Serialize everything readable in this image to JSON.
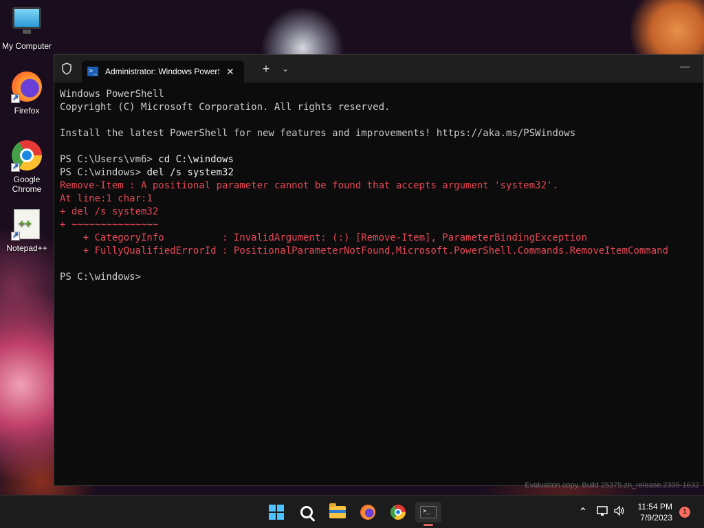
{
  "desktop": {
    "icons": [
      {
        "label": "My Computer",
        "icon": "monitor-icon"
      },
      {
        "label": "Firefox",
        "icon": "firefox-icon"
      },
      {
        "label": "Google Chrome",
        "icon": "chrome-icon"
      },
      {
        "label": "Notepad++",
        "icon": "notepad-plus-plus-icon"
      }
    ],
    "watermark": "Evaluation copy. Build 25375.zn_release.2305-1632"
  },
  "terminal": {
    "tab_title": "Administrator: Windows PowerShell",
    "tab_close": "✕",
    "new_tab": "+",
    "dropdown": "⌄",
    "minimize": "—",
    "lines": [
      {
        "text": "Windows PowerShell",
        "kind": "normal"
      },
      {
        "text": "Copyright (C) Microsoft Corporation. All rights reserved.",
        "kind": "normal"
      },
      {
        "text": "",
        "kind": "normal"
      },
      {
        "text": "Install the latest PowerShell for new features and improvements! https://aka.ms/PSWindows",
        "kind": "normal"
      },
      {
        "text": "",
        "kind": "normal"
      },
      {
        "text": "PS C:\\Users\\vm6> ",
        "cmd": "cd C:\\windows",
        "kind": "prompt"
      },
      {
        "text": "PS C:\\windows> ",
        "cmd": "del /s system32",
        "kind": "prompt"
      },
      {
        "text": "Remove-Item : A positional parameter cannot be found that accepts argument 'system32'.",
        "kind": "error"
      },
      {
        "text": "At line:1 char:1",
        "kind": "error"
      },
      {
        "text": "+ del /s system32",
        "kind": "error"
      },
      {
        "text": "+ ~~~~~~~~~~~~~~~",
        "kind": "error"
      },
      {
        "text": "    + CategoryInfo          : InvalidArgument: (:) [Remove-Item], ParameterBindingException",
        "kind": "error"
      },
      {
        "text": "    + FullyQualifiedErrorId : PositionalParameterNotFound,Microsoft.PowerShell.Commands.RemoveItemCommand",
        "kind": "error"
      },
      {
        "text": "",
        "kind": "normal"
      },
      {
        "text": "PS C:\\windows> ",
        "kind": "prompt"
      }
    ],
    "colors": {
      "background": "#0c0c0c",
      "text": "#cccccc",
      "error": "#e74856"
    }
  },
  "taskbar": {
    "apps": [
      "start-icon",
      "search-icon",
      "file-explorer-icon",
      "firefox-icon",
      "chrome-icon",
      "terminal-icon"
    ],
    "time": "11:54 PM",
    "date": "7/9/2023",
    "notification_count": "1",
    "tray_chevron": "⌃",
    "speaker": "🔊"
  }
}
